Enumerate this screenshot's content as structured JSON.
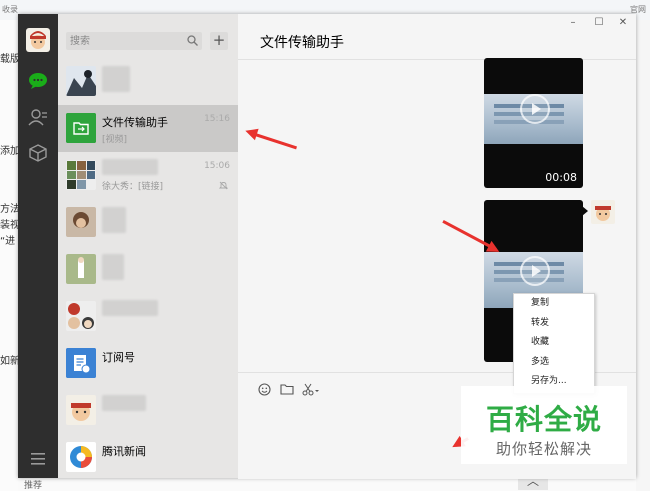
{
  "window": {
    "search_placeholder": "搜索",
    "add_button": "+",
    "chat_title": "文件传输助手",
    "controls": {
      "minimize": "–",
      "maximize": "☐",
      "close": "✕"
    }
  },
  "nav": {
    "icons": [
      "chat-icon",
      "contacts-icon",
      "favorites-icon",
      "menu-icon"
    ]
  },
  "conversations": [
    {
      "name": "",
      "preview": "",
      "time": "",
      "blurred": true
    },
    {
      "name": "文件传输助手",
      "preview": "[视频]",
      "time": "15:16",
      "selected": true
    },
    {
      "name": "",
      "preview": "徐大秀：[链接]",
      "time": "15:06",
      "muted": true,
      "blurred": true
    },
    {
      "name": "",
      "preview": "",
      "time": "",
      "blurred": true
    },
    {
      "name": "",
      "preview": "",
      "time": "",
      "blurred": true
    },
    {
      "name": "",
      "preview": "",
      "time": "",
      "blurred": true
    },
    {
      "name": "订阅号",
      "preview": "",
      "time": ""
    },
    {
      "name": "",
      "preview": "",
      "time": "",
      "blurred": true
    },
    {
      "name": "腾讯新闻",
      "preview": "",
      "time": ""
    }
  ],
  "messages": [
    {
      "type": "video",
      "duration": "00:08"
    },
    {
      "type": "video",
      "duration": ""
    }
  ],
  "context_menu": {
    "items": [
      "复制",
      "转发",
      "收藏",
      "多选",
      "另存为..."
    ]
  },
  "background": {
    "left_fragments": [
      "载版",
      "添加",
      "方法",
      "装视",
      "“进",
      "如新"
    ],
    "top_fragments": [
      "收录",
      "官网"
    ],
    "bottom_fragment": "推荐"
  },
  "watermark": {
    "title": "百科全说",
    "subtitle": "助你轻松解决"
  },
  "colors": {
    "accent_green": "#2fac45",
    "nav_bg": "#2e2e2e",
    "annotation_red": "#e8322e",
    "wechat_green": "#1aad19"
  }
}
